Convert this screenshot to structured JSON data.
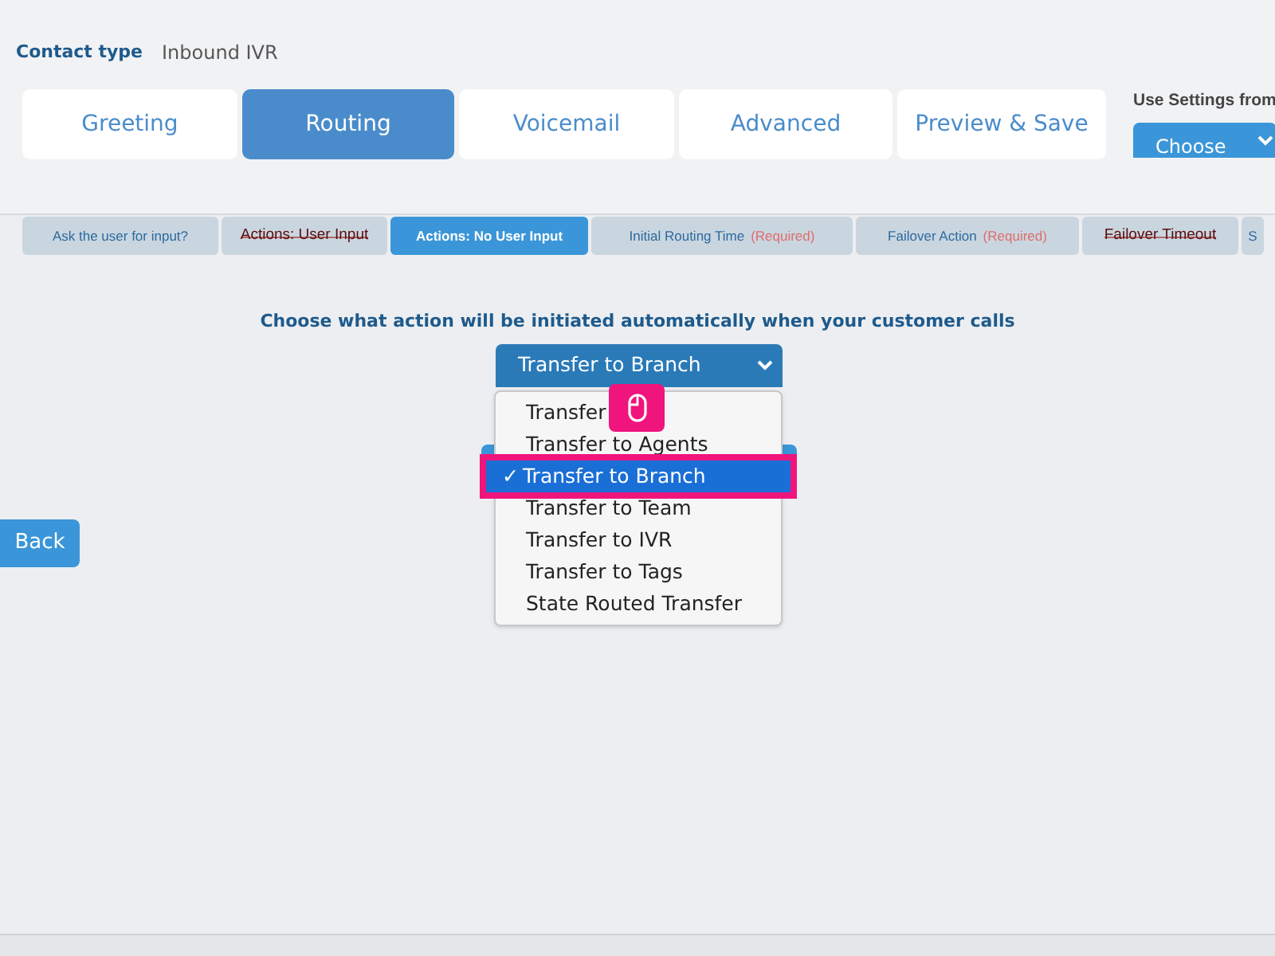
{
  "contact_type": {
    "label": "Contact type",
    "value": "Inbound IVR"
  },
  "tabs": [
    {
      "label": "Greeting",
      "selected": false
    },
    {
      "label": "Routing",
      "selected": true
    },
    {
      "label": "Voicemail",
      "selected": false
    },
    {
      "label": "Advanced",
      "selected": false
    },
    {
      "label": "Preview & Save",
      "selected": false
    }
  ],
  "use_settings": {
    "label": "Use Settings from",
    "dropdown": "Choose"
  },
  "steps": [
    {
      "label": "Ask the user for input?",
      "selected": false,
      "disabled": false,
      "required": false
    },
    {
      "label": "Actions: User Input",
      "selected": false,
      "disabled": true,
      "required": false
    },
    {
      "label": "Actions: No User Input",
      "selected": true,
      "disabled": false,
      "required": false
    },
    {
      "label": "Initial Routing Time",
      "selected": false,
      "disabled": false,
      "required": true,
      "required_text": "(Required)"
    },
    {
      "label": "Failover Action",
      "selected": false,
      "disabled": false,
      "required": true,
      "required_text": "(Required)"
    },
    {
      "label": "Failover Timeout",
      "selected": false,
      "disabled": true,
      "required": false
    },
    {
      "label": "S",
      "selected": false,
      "disabled": false,
      "required": false
    }
  ],
  "prompt": "Choose what action will be initiated automatically when your customer calls",
  "action_select": {
    "value": "Transfer to Branch",
    "options": [
      {
        "label": "Transfer",
        "selected": false
      },
      {
        "label": "Transfer to Agents",
        "selected": false
      },
      {
        "label": "Transfer to Branch",
        "selected": true,
        "check": "✓"
      },
      {
        "label": "Transfer to Team",
        "selected": false
      },
      {
        "label": "Transfer to IVR",
        "selected": false
      },
      {
        "label": "Transfer to Tags",
        "selected": false
      },
      {
        "label": "State Routed Transfer",
        "selected": false
      }
    ]
  },
  "back_button": "Back"
}
